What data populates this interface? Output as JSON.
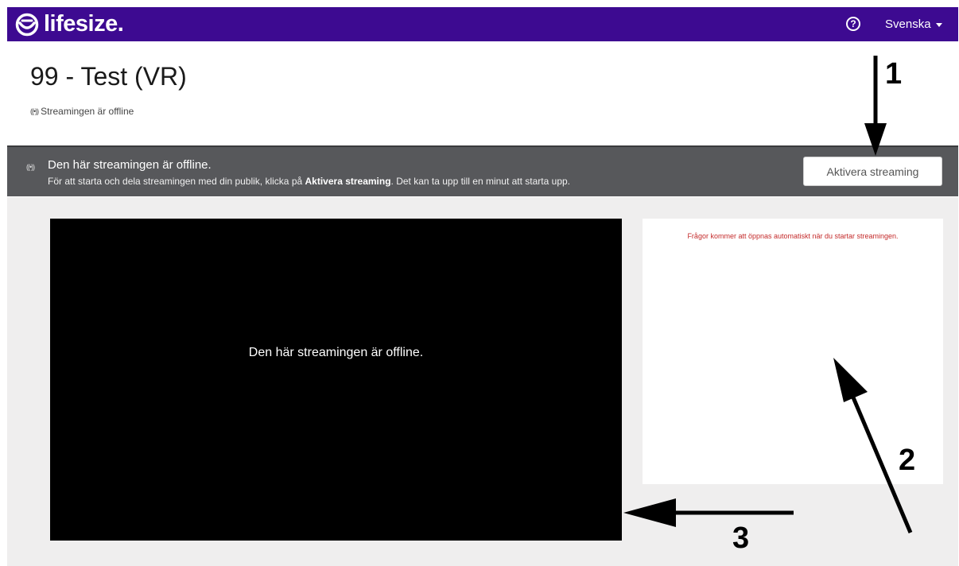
{
  "brand": {
    "name": "lifesize",
    "dot": "."
  },
  "header": {
    "help_symbol": "?",
    "language": "Svenska"
  },
  "page": {
    "title": "99 - Test (VR)",
    "status": "Streamingen är offline"
  },
  "banner": {
    "title": "Den här streamingen är offline.",
    "desc_prefix": "För att starta och dela streamingen med din publik, klicka på ",
    "desc_bold": "Aktivera streaming",
    "desc_suffix": ". Det kan ta upp till en minut att starta upp.",
    "button_label": "Aktivera streaming"
  },
  "video": {
    "message": "Den här streamingen är offline."
  },
  "qa": {
    "message": "Frågor kommer att öppnas automatiskt när du startar streamingen."
  },
  "annotations": {
    "one": "1",
    "two": "2",
    "three": "3"
  },
  "colors": {
    "topbar": "#3d0a91",
    "banner": "#57585b",
    "qa_text": "#c42b2b",
    "content_bg": "#efeeee"
  },
  "icons": {
    "logo": "lifesize-logo-icon",
    "help": "help-icon",
    "caret": "caret-down-icon",
    "broadcast": "broadcast-icon"
  }
}
